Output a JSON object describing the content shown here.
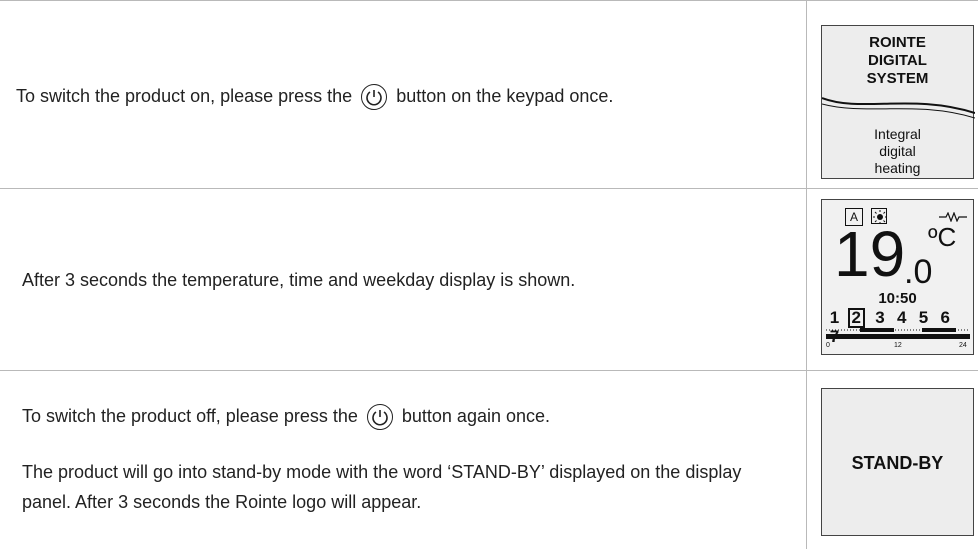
{
  "rows": [
    {
      "text_before": "To switch the product on, please press the",
      "text_after": "button on the keypad once.",
      "panel": {
        "logo_lines": [
          "ROINTE",
          "DIGITAL",
          "SYSTEM"
        ],
        "sub_lines": [
          "Integral",
          "digital",
          "heating"
        ]
      }
    },
    {
      "text": "After 3 seconds the temperature, time and weekday display is shown.",
      "panel": {
        "mode_icon_a": "A",
        "sun_icon": "sun-icon",
        "heating_icon": "resistor-icon",
        "temp_integer": "19",
        "temp_decimal": ".0",
        "unit": "ºC",
        "time": "10:50",
        "days": [
          "1",
          "2",
          "3",
          "4",
          "5",
          "6",
          "7"
        ],
        "selected_day": "2",
        "scale_labels": [
          "0",
          "12",
          "24"
        ]
      }
    },
    {
      "text_before": "To switch the product off, please press the",
      "text_after": "button again once.",
      "paragraph2": "The product will go into stand-by mode with the word ‘STAND-BY’ displayed on the display panel. After 3 seconds the Rointe logo will appear.",
      "panel": {
        "label": "STAND-BY"
      }
    }
  ],
  "icons": {
    "power": "power-icon"
  }
}
